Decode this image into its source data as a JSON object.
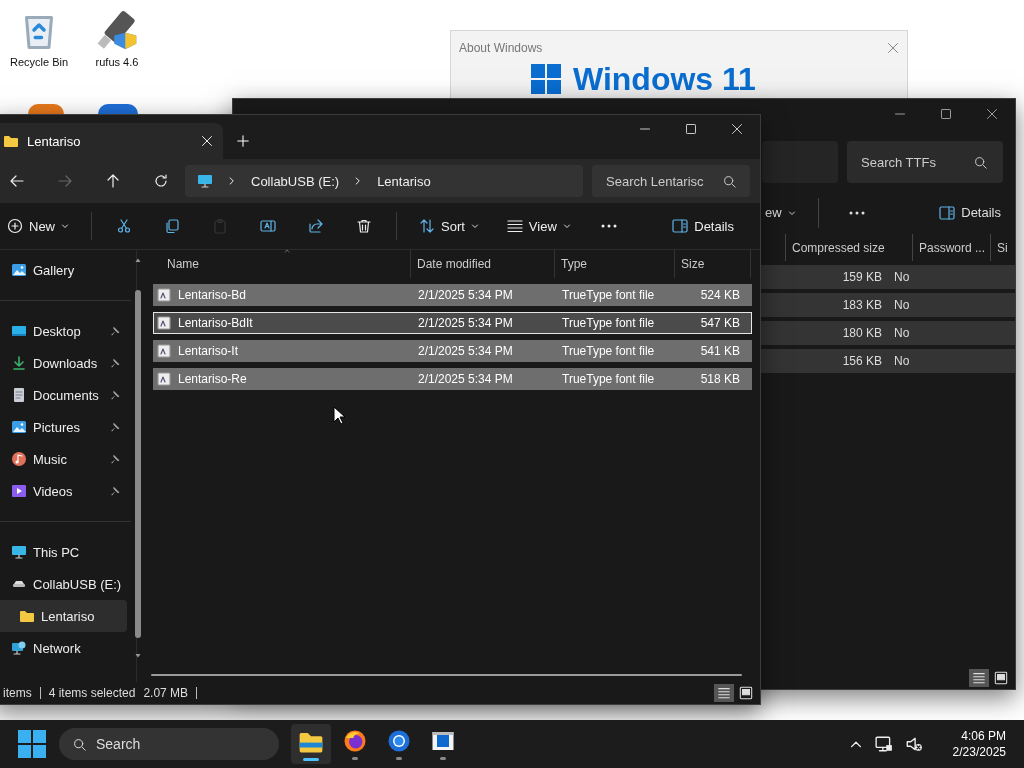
{
  "desktop": {
    "icons": [
      {
        "label": "Recycle Bin",
        "kind": "recycle"
      },
      {
        "label": "rufus 4.6",
        "kind": "usb"
      }
    ]
  },
  "about_window": {
    "title": "About Windows",
    "heading": "Windows 11"
  },
  "back_window": {
    "search": {
      "placeholder": "Search TTFs"
    },
    "toolbar": [
      {
        "kind": "view",
        "label": "ew"
      },
      {
        "kind": "more"
      },
      {
        "kind": "details",
        "label": "Details"
      }
    ],
    "columns": [
      "Compressed size",
      "Password ...",
      "Si"
    ],
    "rows": [
      {
        "compressed_size": "159 KB",
        "password": "No"
      },
      {
        "compressed_size": "183 KB",
        "password": "No"
      },
      {
        "compressed_size": "180 KB",
        "password": "No"
      },
      {
        "compressed_size": "156 KB",
        "password": "No"
      }
    ]
  },
  "explorer": {
    "tabs": [
      {
        "label": "Lentariso",
        "selected": true
      }
    ],
    "nav": [
      {
        "kind": "back",
        "disabled": false
      },
      {
        "kind": "forward",
        "disabled": true
      },
      {
        "kind": "up",
        "disabled": false
      },
      {
        "kind": "refresh",
        "disabled": false
      }
    ],
    "breadcrumb": [
      "CollabUSB (E:)",
      "Lentariso"
    ],
    "search": {
      "placeholder": "Search Lentarisc"
    },
    "toolbar": {
      "groups": [
        [
          {
            "kind": "new",
            "label": "New",
            "disabled": false
          }
        ],
        [
          {
            "kind": "cut",
            "disabled": false
          },
          {
            "kind": "copy",
            "disabled": false
          },
          {
            "kind": "paste",
            "disabled": true
          },
          {
            "kind": "rename",
            "disabled": false
          },
          {
            "kind": "share",
            "disabled": false
          },
          {
            "kind": "delete",
            "disabled": false
          }
        ],
        [
          {
            "kind": "sort",
            "label": "Sort",
            "disabled": false
          },
          {
            "kind": "view",
            "label": "View",
            "disabled": false
          },
          {
            "kind": "more",
            "disabled": false
          }
        ]
      ],
      "right": [
        {
          "kind": "details",
          "label": "Details",
          "disabled": false
        }
      ]
    },
    "sidebar": {
      "groups": [
        [
          {
            "label": "Gallery",
            "kind": "gallery",
            "pinned": false,
            "selected": false
          }
        ],
        [
          {
            "label": "Desktop",
            "kind": "desktop",
            "pinned": true,
            "selected": false
          },
          {
            "label": "Downloads",
            "kind": "downloads",
            "pinned": true,
            "selected": false
          },
          {
            "label": "Documents",
            "kind": "documents",
            "pinned": true,
            "selected": false
          },
          {
            "label": "Pictures",
            "kind": "pictures",
            "pinned": true,
            "selected": false
          },
          {
            "label": "Music",
            "kind": "music",
            "pinned": true,
            "selected": false
          },
          {
            "label": "Videos",
            "kind": "videos",
            "pinned": true,
            "selected": false
          }
        ],
        [
          {
            "label": "This PC",
            "kind": "pc",
            "pinned": false,
            "selected": false
          },
          {
            "label": "CollabUSB (E:)",
            "kind": "drive",
            "pinned": false,
            "selected": false,
            "children": [
              {
                "label": "Lentariso",
                "kind": "folder",
                "pinned": false,
                "selected": true
              }
            ]
          },
          {
            "label": "Network",
            "kind": "network",
            "pinned": false,
            "selected": false
          }
        ]
      ]
    },
    "files": {
      "columns": [
        {
          "label": "Name",
          "sorted": true
        },
        {
          "label": "Date modified",
          "sorted": false
        },
        {
          "label": "Type",
          "sorted": false
        },
        {
          "label": "Size",
          "sorted": false
        }
      ],
      "rows": [
        {
          "name": "Lentariso-Bd",
          "date": "2/1/2025 5:34 PM",
          "type": "TrueType font file",
          "size": "524 KB",
          "selected": true,
          "focused": false
        },
        {
          "name": "Lentariso-BdIt",
          "date": "2/1/2025 5:34 PM",
          "type": "TrueType font file",
          "size": "547 KB",
          "selected": true,
          "focused": true
        },
        {
          "name": "Lentariso-It",
          "date": "2/1/2025 5:34 PM",
          "type": "TrueType font file",
          "size": "541 KB",
          "selected": true,
          "focused": false
        },
        {
          "name": "Lentariso-Re",
          "date": "2/1/2025 5:34 PM",
          "type": "TrueType font file",
          "size": "518 KB",
          "selected": true,
          "focused": false
        }
      ]
    },
    "status_bar": {
      "items": "items",
      "selection": "4 items selected",
      "size": "2.07 MB",
      "view_modes": [
        {
          "kind": "details",
          "selected": true
        },
        {
          "kind": "tiles",
          "selected": false
        }
      ]
    }
  },
  "taskbar": {
    "search": {
      "placeholder": "Search"
    },
    "apps": [
      {
        "kind": "explorer",
        "selected": true
      },
      {
        "kind": "firefox",
        "selected": false
      },
      {
        "kind": "chrome",
        "selected": false
      },
      {
        "kind": "app",
        "selected": false
      }
    ],
    "clock": {
      "time": "4:06 PM",
      "date": "2/23/2025"
    }
  }
}
